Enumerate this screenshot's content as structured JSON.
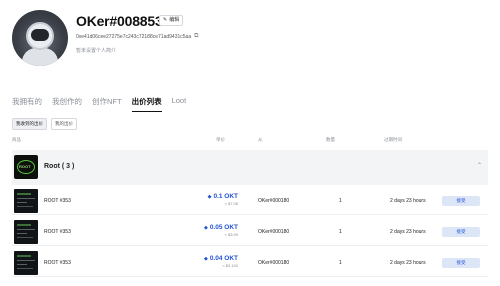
{
  "profile": {
    "username": "OKer#008853",
    "edit_label": "编辑",
    "address": "0xe41d06cee27275e7c243c72188ce71ad9431c5aa",
    "bio": "暂未设置个人简介"
  },
  "tabs": [
    {
      "label": "我拥有的"
    },
    {
      "label": "我创作的"
    },
    {
      "label": "创作NFT"
    },
    {
      "label": "出价列表"
    },
    {
      "label": "Loot"
    }
  ],
  "subtabs": [
    {
      "label": "我收到的出价"
    },
    {
      "label": "我的出价"
    }
  ],
  "table_headers": {
    "item": "商品",
    "price": "单价",
    "from": "从",
    "quantity": "数量",
    "expires": "过期时间"
  },
  "group": {
    "name": "Root ( 3 )",
    "thumb_text": "ROOT"
  },
  "rows": [
    {
      "name": "ROOT #353",
      "price": "0.1 OKT",
      "usd": "≈ $7.08",
      "from": "OKer#000180",
      "quantity": "1",
      "expires": "2 days 23 hours",
      "action": "接受"
    },
    {
      "name": "ROOT #353",
      "price": "0.05 OKT",
      "usd": "≈ $3.99",
      "from": "OKer#000180",
      "quantity": "1",
      "expires": "2 days 23 hours",
      "action": "接受"
    },
    {
      "name": "ROOT #353",
      "price": "0.04 OKT",
      "usd": "≈ $3.192",
      "from": "OKer#000180",
      "quantity": "1",
      "expires": "2 days 23 hours",
      "action": "接受"
    }
  ],
  "icons": {
    "edit": "edit-icon",
    "copy": "copy-icon",
    "collapse": "chevron-up-icon",
    "currency": "okt-diamond-icon"
  },
  "colors": {
    "accent": "#2152d6",
    "accent_bg": "#dde6f7",
    "group_bg": "#f3f4f6"
  }
}
